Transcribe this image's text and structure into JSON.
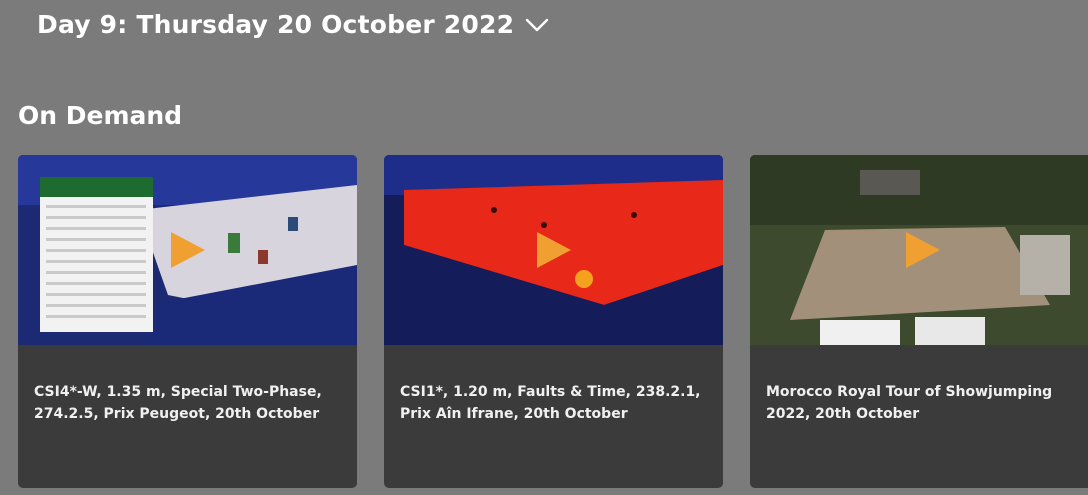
{
  "header": {
    "day_label": "Day 9: Thursday 20 October 2022",
    "dropdown_icon": "chevron-down-icon"
  },
  "section": {
    "title": "On Demand"
  },
  "cards": [
    {
      "title": "CSI4*-W, 1.35 m, Special Two-Phase, 274.2.5, Prix Peugeot, 20th October"
    },
    {
      "title": "CSI1*, 1.20 m, Faults & Time, 238.2.1, Prix Aîn Ifrane, 20th October"
    },
    {
      "title": "Morocco Royal Tour of Showjumping 2022, 20th October"
    }
  ],
  "colors": {
    "page_bg": "#7b7b7b",
    "card_bg": "#3b3b3b",
    "play_accent": "#f0a030"
  }
}
